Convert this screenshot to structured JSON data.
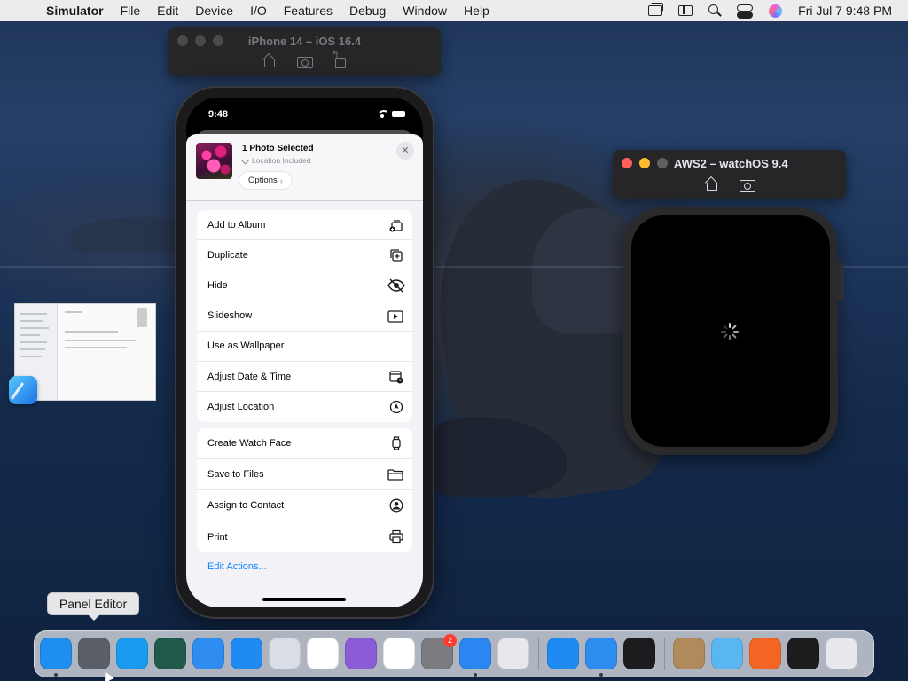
{
  "menubar": {
    "app_name": "Simulator",
    "items": [
      "File",
      "Edit",
      "Device",
      "I/O",
      "Features",
      "Debug",
      "Window",
      "Help"
    ],
    "clock": "Fri Jul 7  9:48 PM"
  },
  "iphone_window": {
    "title": "iPhone 14 – iOS 16.4",
    "toolbar_icons": [
      "home-icon",
      "screenshot-icon",
      "rotate-icon"
    ]
  },
  "watch_window": {
    "title": "AWS2 – watchOS 9.4",
    "toolbar_icons": [
      "home-icon",
      "screenshot-icon"
    ],
    "traffic_colors": [
      "#ff5f57",
      "#febc2e",
      "#5f5f62"
    ]
  },
  "iphone": {
    "status_time": "9:48",
    "share_sheet": {
      "title": "1 Photo Selected",
      "subtitle": "Location Included",
      "options_label": "Options",
      "groups": [
        [
          {
            "label": "Add to Album",
            "icon": "add-to-album-icon"
          },
          {
            "label": "Duplicate",
            "icon": "duplicate-icon"
          },
          {
            "label": "Hide",
            "icon": "eye-slash-icon"
          },
          {
            "label": "Slideshow",
            "icon": "play-icon"
          },
          {
            "label": "Use as Wallpaper",
            "icon": ""
          },
          {
            "label": "Adjust Date & Time",
            "icon": "calendar-clock-icon"
          },
          {
            "label": "Adjust Location",
            "icon": "location-icon"
          }
        ],
        [
          {
            "label": "Create Watch Face",
            "icon": "watch-icon"
          },
          {
            "label": "Save to Files",
            "icon": "folder-icon"
          },
          {
            "label": "Assign to Contact",
            "icon": "contact-icon"
          },
          {
            "label": "Print",
            "icon": "printer-icon"
          }
        ]
      ],
      "edit_actions": "Edit Actions..."
    }
  },
  "tooltip": "Panel Editor",
  "dock": {
    "apps": [
      {
        "name": "Finder",
        "icon": "finder-icon",
        "color": "#1e8ef0",
        "running": true
      },
      {
        "name": "Panel Editor",
        "icon": "panel-editor-icon",
        "color": "#5b6068",
        "running": false
      },
      {
        "name": "Safari",
        "icon": "safari-icon",
        "color": "#1a9bf0",
        "running": false
      },
      {
        "name": "Time Machine",
        "icon": "time-machine-icon",
        "color": "#1f5a4a",
        "running": false
      },
      {
        "name": "Mission Control",
        "icon": "mission-control-icon",
        "color": "#2f8cf0",
        "running": false
      },
      {
        "name": "App Store",
        "icon": "app-store-icon",
        "color": "#1f8af2",
        "running": false
      },
      {
        "name": "Xcode Tools",
        "icon": "xcode-tools-icon",
        "color": "#d8dde6",
        "running": false
      },
      {
        "name": "Chrome",
        "icon": "chrome-icon",
        "color": "#ffffff",
        "running": false
      },
      {
        "name": "Visual Studio",
        "icon": "visual-studio-icon",
        "color": "#8a5cd6",
        "running": false
      },
      {
        "name": "VS Code",
        "icon": "vscode-icon",
        "color": "#ffffff",
        "running": false
      },
      {
        "name": "System Settings",
        "icon": "settings-icon",
        "color": "#7c7c80",
        "running": false,
        "badge": "2"
      },
      {
        "name": "Simulator",
        "icon": "simulator-icon",
        "color": "#2a86f0",
        "running": true
      },
      {
        "name": "Launchpad",
        "icon": "launchpad-icon",
        "color": "#e8e8ec",
        "running": false
      }
    ],
    "apps_right": [
      {
        "name": "App Store",
        "icon": "app-store-icon",
        "color": "#1f8af2",
        "running": false
      },
      {
        "name": "Xcode",
        "icon": "xcode-icon",
        "color": "#2d8cf0",
        "running": true
      },
      {
        "name": "Activity Monitor",
        "icon": "activity-monitor-icon",
        "color": "#1c1c1e",
        "running": false
      }
    ],
    "apps_stack": [
      {
        "name": "Archive",
        "icon": "archive-icon",
        "color": "#b08a5a",
        "running": false
      },
      {
        "name": "Folder",
        "icon": "folder-icon",
        "color": "#5ab6f0",
        "running": false
      },
      {
        "name": "Firefox",
        "icon": "firefox-icon",
        "color": "#f26522",
        "running": false
      },
      {
        "name": "Activity Monitor",
        "icon": "activity-monitor-icon",
        "color": "#1c1c1e",
        "running": false
      },
      {
        "name": "Trash",
        "icon": "trash-icon",
        "color": "#e8e9ec",
        "running": false
      }
    ]
  }
}
